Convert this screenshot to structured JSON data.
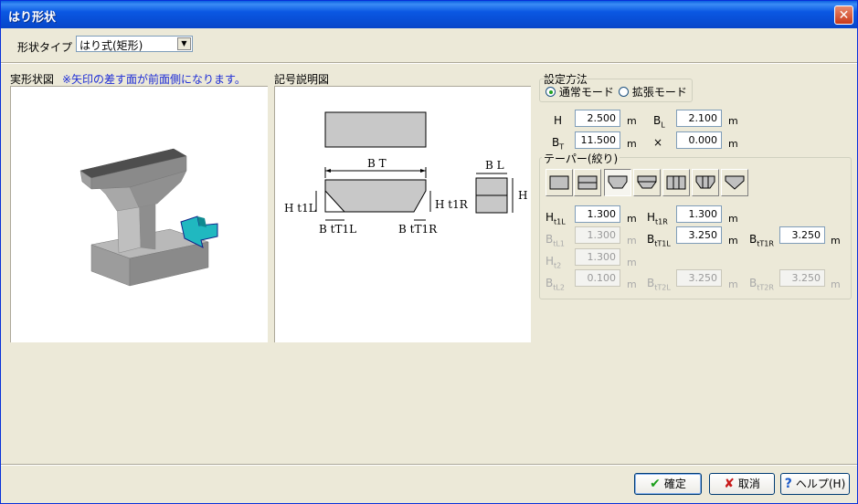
{
  "window": {
    "title": "はり形状"
  },
  "shape_type": {
    "label": "形状タイプ",
    "value": "はり式(矩形)"
  },
  "left_panel": {
    "title": "実形状図",
    "note": "※矢印の差す面が前面側になります。"
  },
  "middle_panel": {
    "title": "記号説明図",
    "labels": {
      "bt": "B T",
      "bl": "B L",
      "h": "H",
      "ht1l": "H t1L",
      "ht1r": "H t1R",
      "btt1l": "B tT1L",
      "btt1r": "B tT1R"
    }
  },
  "settings": {
    "method_label": "設定方法",
    "mode_normal": "通常モード",
    "mode_extended": "拡張モード",
    "selected_mode": "通常モード"
  },
  "dims": {
    "H": "2.500",
    "BL": "2.100",
    "BT": "11.500",
    "x": "0.000",
    "unit": "m",
    "x_label": "×"
  },
  "taper": {
    "label": "テーパー(絞り)",
    "buttons": [
      "taper-none",
      "taper-horizontal-split",
      "taper-bottom-both",
      "taper-top-bottom",
      "taper-vertical-split",
      "taper-bottom-vertical",
      "taper-bottom-v"
    ],
    "selected_index": 2,
    "Ht1L": "1.300",
    "Ht1R": "1.300",
    "BtL1": "1.300",
    "BtT1L": "3.250",
    "BtT1R": "3.250",
    "Ht2": "1.300",
    "BtL2": "0.100",
    "BtT2L": "3.250",
    "BtT2R": "3.250"
  },
  "buttons": {
    "ok": "確定",
    "cancel": "取消",
    "help": "ヘルプ(H)"
  },
  "colors": {
    "title_bar": "#0a58e3",
    "ok_icon": "#1a9e1a",
    "cancel_icon": "#c81a1a",
    "help_icon": "#1a5ac8",
    "model_teal": "#20b8c0",
    "model_gray": "#9a9a9a"
  }
}
